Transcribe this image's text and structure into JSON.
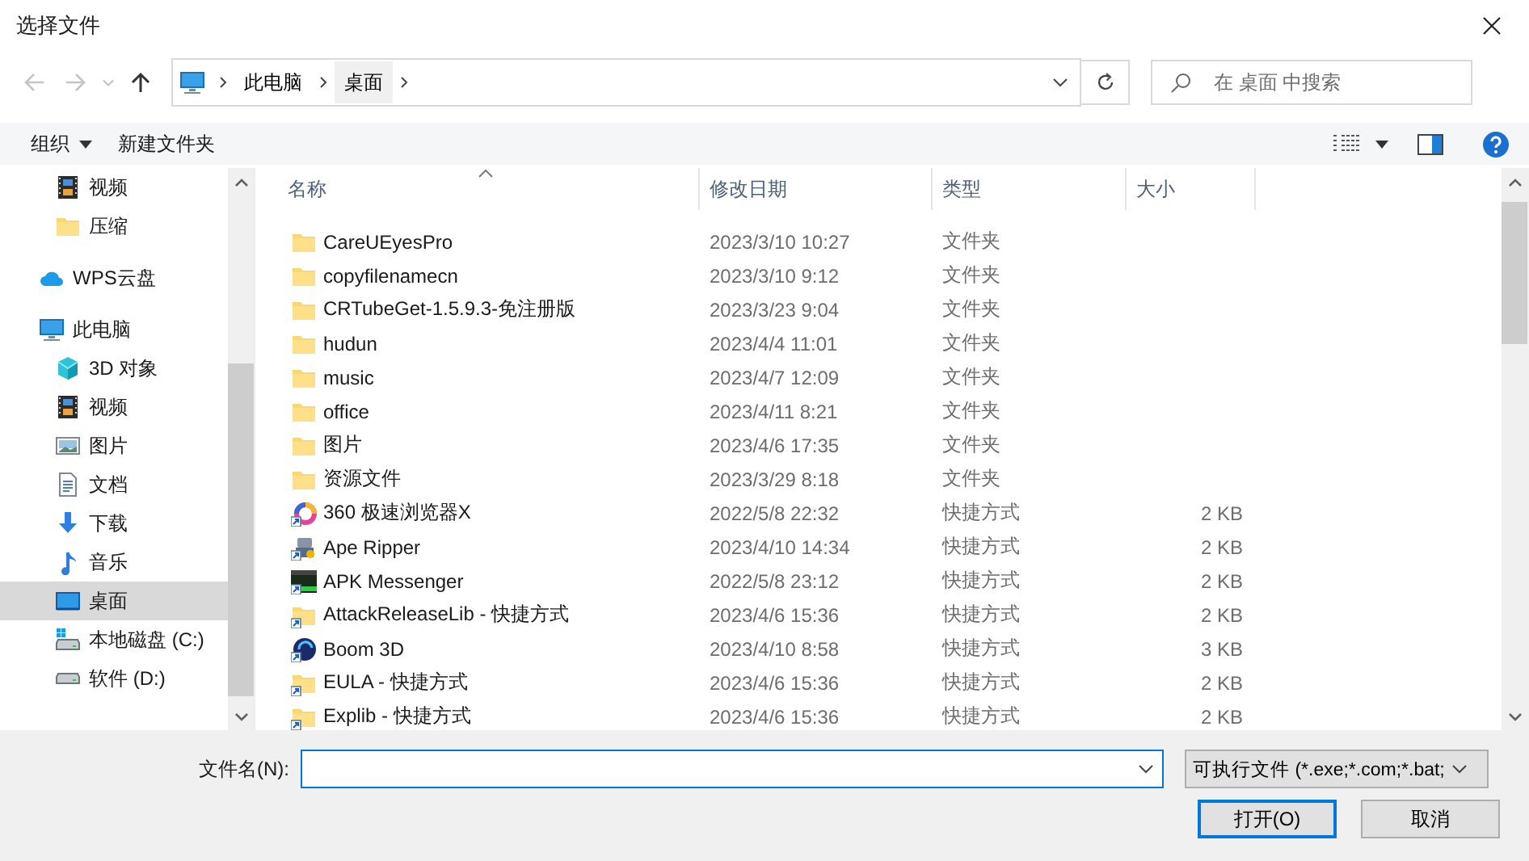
{
  "window": {
    "title": "选择文件"
  },
  "navigation": {
    "buttons": [
      {
        "kind": "back",
        "disabled": true
      },
      {
        "kind": "forward",
        "disabled": true
      },
      {
        "kind": "recent",
        "disabled": true
      },
      {
        "kind": "up",
        "disabled": false
      }
    ],
    "path": [
      {
        "label": "此电脑",
        "selected": false
      },
      {
        "label": "桌面",
        "selected": true
      }
    ],
    "search": {
      "placeholder": "在 桌面 中搜索"
    }
  },
  "toolbar": {
    "buttons": [
      {
        "label": "组织",
        "menu": true
      },
      {
        "label": "新建文件夹",
        "menu": false
      }
    ]
  },
  "nav_pane": {
    "quick_access": [
      {
        "label": "视频",
        "kind": "video",
        "selected": false
      },
      {
        "label": "压缩",
        "kind": "folder",
        "selected": false
      }
    ],
    "locations": [
      {
        "label": "WPS云盘",
        "kind": "cloud",
        "selected": false
      },
      {
        "label": "此电脑",
        "kind": "pc",
        "selected": false,
        "children": [
          {
            "label": "3D 对象",
            "kind": "cube",
            "selected": false
          },
          {
            "label": "视频",
            "kind": "video",
            "selected": false
          },
          {
            "label": "图片",
            "kind": "picture",
            "selected": false
          },
          {
            "label": "文档",
            "kind": "doc",
            "selected": false
          },
          {
            "label": "下载",
            "kind": "download",
            "selected": false
          },
          {
            "label": "音乐",
            "kind": "music",
            "selected": false
          },
          {
            "label": "桌面",
            "kind": "desktop",
            "selected": true
          },
          {
            "label": "本地磁盘 (C:)",
            "kind": "drive-system",
            "selected": false
          },
          {
            "label": "软件 (D:)",
            "kind": "drive",
            "selected": false
          }
        ]
      }
    ]
  },
  "table": {
    "columns": [
      {
        "label": "名称",
        "sorted": true
      },
      {
        "label": "修改日期",
        "sorted": false
      },
      {
        "label": "类型",
        "sorted": false
      },
      {
        "label": "大小",
        "sorted": false
      }
    ],
    "rows": [
      {
        "kind": "folder",
        "name": "CareUEyesPro",
        "date": "2023/3/10 10:27",
        "type": "文件夹"
      },
      {
        "kind": "folder",
        "name": "copyfilenamecn",
        "date": "2023/3/10 9:12",
        "type": "文件夹"
      },
      {
        "kind": "folder",
        "name": "CRTubeGet-1.5.9.3-免注册版",
        "date": "2023/3/23 9:04",
        "type": "文件夹"
      },
      {
        "kind": "folder",
        "name": "hudun",
        "date": "2023/4/4 11:01",
        "type": "文件夹"
      },
      {
        "kind": "folder",
        "name": "music",
        "date": "2023/4/7 12:09",
        "type": "文件夹"
      },
      {
        "kind": "folder",
        "name": "office",
        "date": "2023/4/11 8:21",
        "type": "文件夹"
      },
      {
        "kind": "folder",
        "name": "图片",
        "date": "2023/4/6 17:35",
        "type": "文件夹"
      },
      {
        "kind": "folder",
        "name": "资源文件",
        "date": "2023/3/29 8:18",
        "type": "文件夹"
      },
      {
        "kind": "ring",
        "name": "360 极速浏览器X",
        "date": "2022/5/8 22:32",
        "type": "快捷方式",
        "size": "2 KB"
      },
      {
        "kind": "robot",
        "name": "Ape Ripper",
        "date": "2023/4/10 14:34",
        "type": "快捷方式",
        "size": "2 KB"
      },
      {
        "kind": "terminal",
        "name": "APK Messenger",
        "date": "2022/5/8 23:12",
        "type": "快捷方式",
        "size": "2 KB"
      },
      {
        "kind": "folder-link",
        "name": "AttackReleaseLib - 快捷方式",
        "date": "2023/4/6 15:36",
        "type": "快捷方式",
        "size": "2 KB"
      },
      {
        "kind": "disc",
        "name": "Boom 3D",
        "date": "2023/4/10 8:58",
        "type": "快捷方式",
        "size": "3 KB"
      },
      {
        "kind": "folder-link",
        "name": "EULA - 快捷方式",
        "date": "2023/4/6 15:36",
        "type": "快捷方式",
        "size": "2 KB"
      },
      {
        "kind": "folder-link",
        "name": "Explib - 快捷方式",
        "date": "2023/4/6 15:36",
        "type": "快捷方式",
        "size": "2 KB"
      }
    ]
  },
  "footer": {
    "filename_label": "文件名(N):",
    "filter": "可执行文件 (*.exe;*.com;*.bat;",
    "buttons": [
      {
        "label": "打开(O)",
        "default": true
      },
      {
        "label": "取消",
        "default": false
      }
    ]
  }
}
